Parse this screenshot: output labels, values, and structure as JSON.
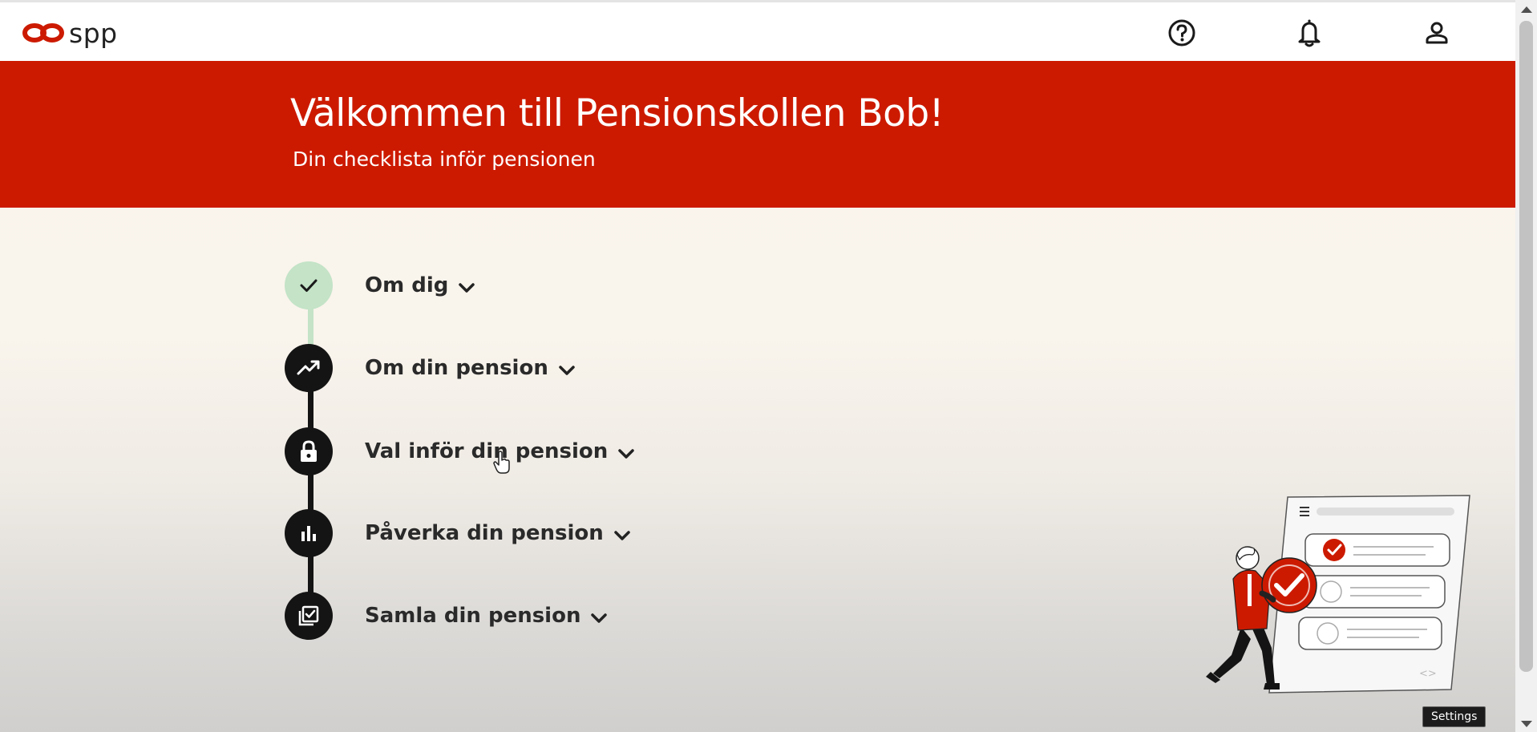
{
  "brand": {
    "name": "spp",
    "color": "#cc1a00"
  },
  "header": {
    "icons": [
      "help-icon",
      "bell-icon",
      "user-icon"
    ]
  },
  "hero": {
    "title": "Välkommen till Pensionskollen Bob!",
    "subtitle": "Din checklista inför pensionen",
    "background": "#cc1a00"
  },
  "checklist": {
    "steps": [
      {
        "label": "Om dig",
        "icon": "checkmark-icon",
        "status": "completed"
      },
      {
        "label": "Om din pension",
        "icon": "trending-up-icon",
        "status": "pending"
      },
      {
        "label": "Val inför din pension",
        "icon": "lock-icon",
        "status": "pending"
      },
      {
        "label": "Påverka din pension",
        "icon": "bar-chart-icon",
        "status": "pending"
      },
      {
        "label": "Samla din pension",
        "icon": "collection-check-icon",
        "status": "pending"
      }
    ]
  },
  "tooltip": {
    "text": "Settings"
  }
}
